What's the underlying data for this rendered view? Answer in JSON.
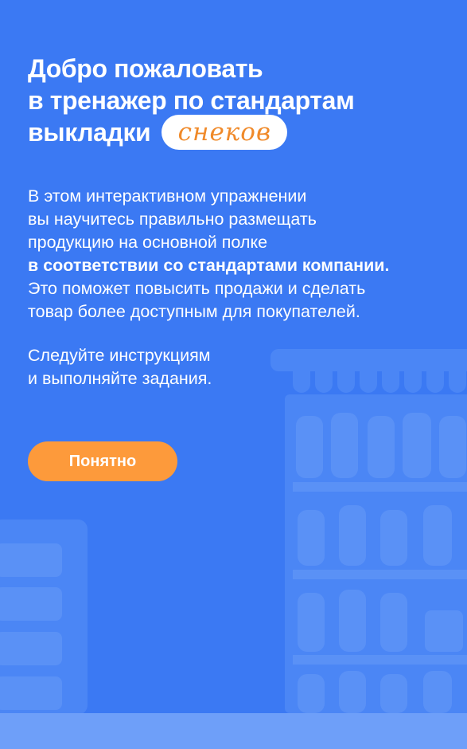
{
  "welcome": {
    "title_line1": "Добро пожаловать",
    "title_line2": "в тренажер по стандартам",
    "title_line3": "выкладки",
    "title_highlight": "снеков"
  },
  "intro": {
    "line1": "В этом интерактивном упражнении",
    "line2": "вы научитесь правильно размещать",
    "line3": "продукцию на основной полке",
    "line4_bold": "в соответствии со стандартами компании.",
    "line5": "Это поможет повысить продажи и сделать",
    "line6": "товар более доступным для покупателей."
  },
  "instructions": {
    "line1": "Следуйте инструкциям",
    "line2": "и выполняйте задания."
  },
  "action": {
    "button_label": "Понятно"
  },
  "colors": {
    "background": "#3b79f3",
    "accent_button": "#fd9a3b",
    "highlight_text": "#f08a2a"
  },
  "illustration": {
    "icon": "store-shelf-illustration"
  }
}
